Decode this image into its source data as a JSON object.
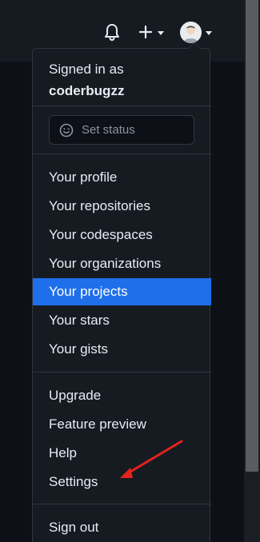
{
  "header": {
    "bell_icon": "bell-icon",
    "plus_icon": "plus-icon",
    "avatar_icon": "avatar"
  },
  "menu": {
    "signed_in_label": "Signed in as",
    "username": "coderbugzz",
    "status_placeholder": "Set status",
    "items_group1": [
      "Your profile",
      "Your repositories",
      "Your codespaces",
      "Your organizations",
      "Your projects",
      "Your stars",
      "Your gists"
    ],
    "active_item": "Your projects",
    "items_group2": [
      "Upgrade",
      "Feature preview",
      "Help",
      "Settings"
    ],
    "sign_out": "Sign out"
  },
  "colors": {
    "background": "#0d1117",
    "header": "#161b22",
    "menu_bg": "#161b22",
    "border": "#30363d",
    "active": "#1f6feb",
    "annotation_arrow": "#e5231b"
  }
}
